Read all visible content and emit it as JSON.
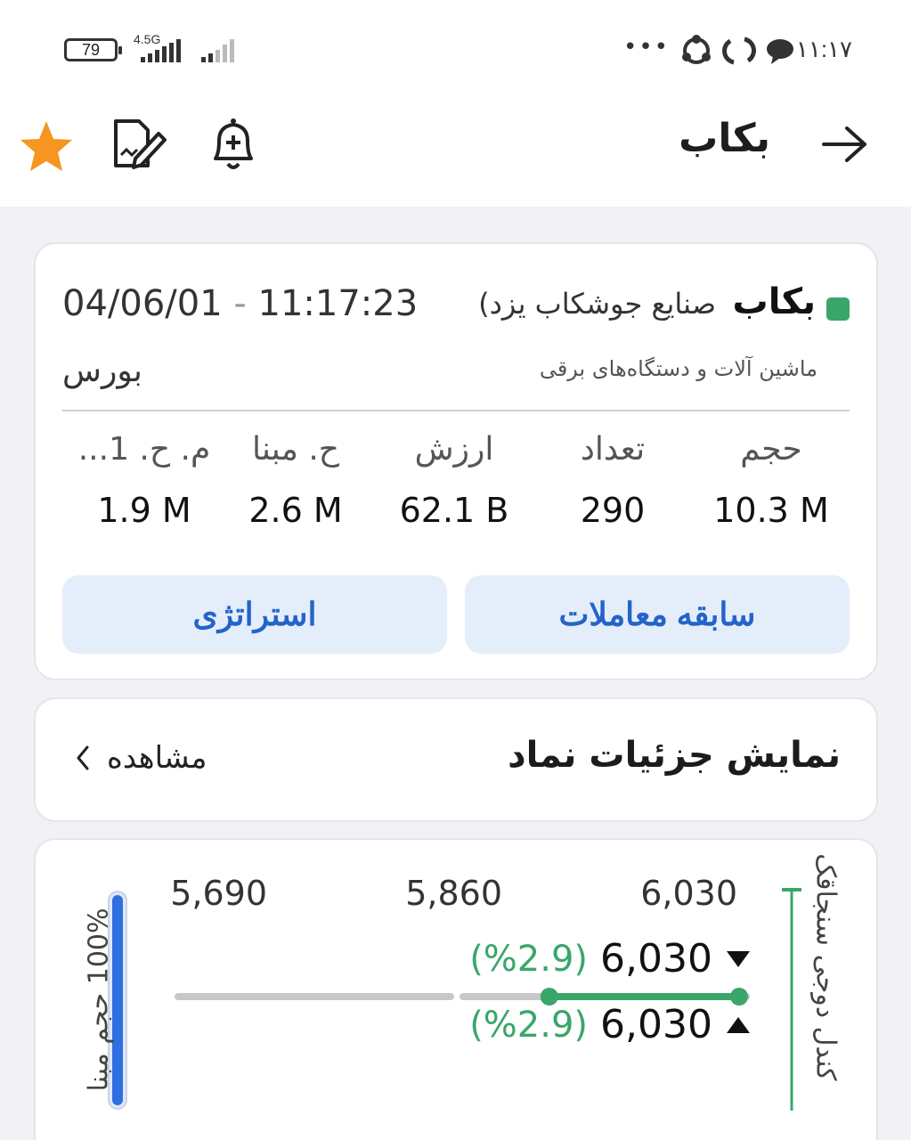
{
  "status_bar": {
    "battery": "79",
    "network": "4.5G",
    "time": "۱۱:۱۷",
    "dots": "•••"
  },
  "header": {
    "title": "بکاب",
    "icons": [
      "back-arrow-icon",
      "bell-plus-icon",
      "document-edit-icon",
      "star-icon"
    ]
  },
  "symbol": {
    "ticker": "بکاب",
    "company": "صنایع جوشکاب یزد)",
    "industry": "ماشین آلات و دستگاه‌های برقی",
    "market": "بورس",
    "time": "11:17:23",
    "separator": "-",
    "date": "04/06/01",
    "status_color": "#3aa66a"
  },
  "stats": [
    {
      "label": "حجم",
      "value": "10.3 M"
    },
    {
      "label": "تعداد",
      "value": "290"
    },
    {
      "label": "ارزش",
      "value": "62.1 B"
    },
    {
      "label": "ح. مبنا",
      "value": "2.6 M"
    },
    {
      "label": "م. ح. 1...",
      "value": "1.9 M"
    }
  ],
  "buttons": {
    "history": "سابقه معاملات",
    "strategy": "استراتژی"
  },
  "details": {
    "title": "نمایش جزئیات نماد",
    "view_label": "مشاهده"
  },
  "price_panel": {
    "right_label": "کندل دوجی سنجاقک",
    "left_label": "100% حجم مبنا",
    "ticks": [
      "6,030",
      "5,860",
      "5,690"
    ],
    "high": {
      "value": "6,030",
      "pct": "(%2.9)"
    },
    "low": {
      "value": "6,030",
      "pct": "(%2.9)"
    },
    "range_fill": 0.33,
    "volume_fill": 1.0,
    "accent": "#3aa66a",
    "volume_color": "#2f6fe0"
  }
}
